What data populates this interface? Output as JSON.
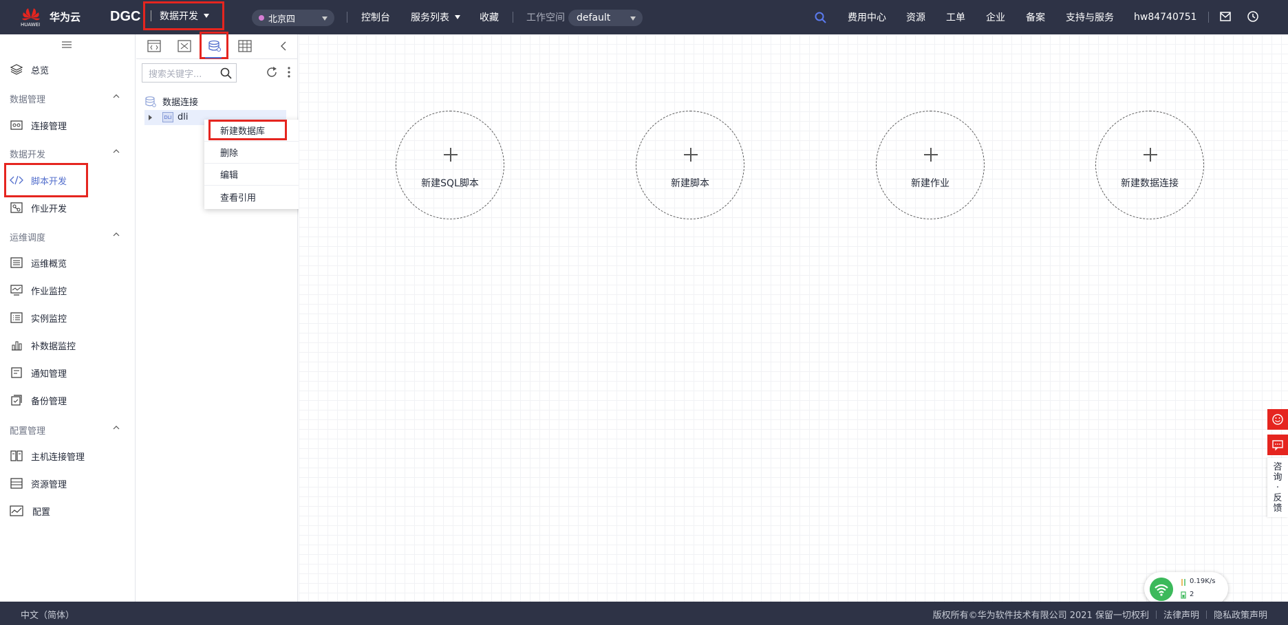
{
  "header": {
    "brand": "华为云",
    "brand_sub": "HUAWEI",
    "product": "DGC",
    "module": "数据开发",
    "region": "北京四",
    "nav": [
      "控制台",
      "服务列表",
      "收藏"
    ],
    "workspace_label": "工作空间",
    "workspace_value": "default",
    "right_nav": [
      "费用中心",
      "资源",
      "工单",
      "企业",
      "备案",
      "支持与服务"
    ],
    "username": "hw84740751",
    "icons": [
      "search-icon",
      "mail-icon",
      "clock-icon"
    ]
  },
  "sidebar": {
    "overview": "总览",
    "groups": [
      {
        "title": "数据管理",
        "items": [
          "连接管理"
        ]
      },
      {
        "title": "数据开发",
        "items": [
          "脚本开发",
          "作业开发"
        ]
      },
      {
        "title": "运维调度",
        "items": [
          "运维概览",
          "作业监控",
          "实例监控",
          "补数据监控",
          "通知管理",
          "备份管理"
        ]
      },
      {
        "title": "配置管理",
        "items": [
          "主机连接管理",
          "资源管理",
          "配置"
        ]
      }
    ],
    "active_item": "脚本开发"
  },
  "tree": {
    "search_placeholder": "搜索关键字...",
    "root_label": "数据连接",
    "node_label": "dli",
    "node_icon_text": "DLI"
  },
  "context_menu": {
    "items": [
      "新建数据库",
      "删除",
      "编辑",
      "查看引用"
    ]
  },
  "main": {
    "actions": [
      "新建SQL脚本",
      "新建脚本",
      "新建作业",
      "新建数据连接"
    ]
  },
  "float": {
    "consult_text": "咨询·反馈"
  },
  "speed_widget": {
    "speed": "0.19K/s",
    "count": "2"
  },
  "footer": {
    "language": "中文（简体）",
    "copyright": "版权所有©华为软件技术有限公司 2021 保留一切权利",
    "legal": "法律声明",
    "privacy": "隐私政策声明"
  },
  "colors": {
    "header_bg": "#2e3346",
    "accent": "#526ecc",
    "highlight_red": "#e5251f"
  }
}
